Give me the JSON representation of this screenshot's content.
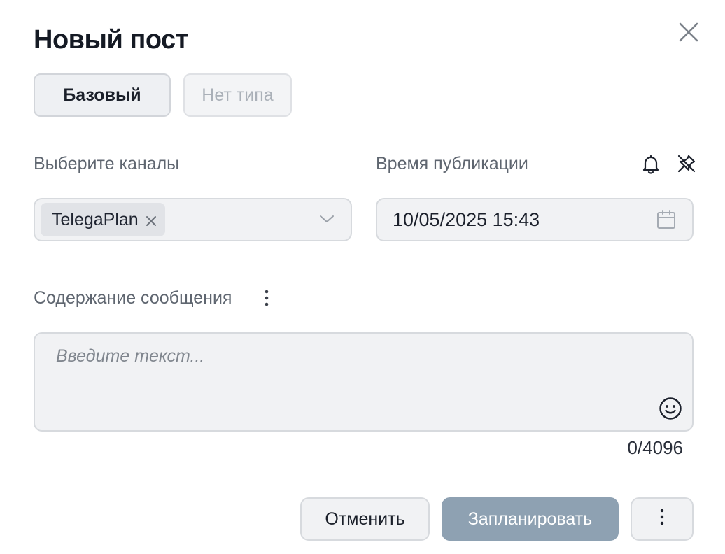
{
  "dialog": {
    "title": "Новый пост"
  },
  "post_types": [
    {
      "label": "Базовый",
      "active": true
    },
    {
      "label": "Нет типа",
      "active": false
    }
  ],
  "channels": {
    "label": "Выберите каналы",
    "selected": [
      "TelegaPlan"
    ]
  },
  "publish_time": {
    "label": "Время публикации",
    "value": "10/05/2025 15:43"
  },
  "content": {
    "label": "Содержание сообщения",
    "placeholder": "Введите текст...",
    "counter": "0/4096"
  },
  "actions": {
    "cancel_label": "Отменить",
    "schedule_label": "Запланировать"
  },
  "colors": {
    "primary_disabled": "#8ea1b2",
    "field_bg": "#f1f2f4",
    "border": "#d7dade"
  },
  "icons": {
    "close": "close-icon",
    "notification": "bell-icon",
    "pin": "pin-off-icon",
    "chip_remove": "close-icon",
    "dropdown": "chevron-down-icon",
    "calendar": "calendar-icon",
    "content_menu": "more-vertical-icon",
    "emoji": "smile-icon",
    "more_actions": "more-vertical-icon"
  }
}
